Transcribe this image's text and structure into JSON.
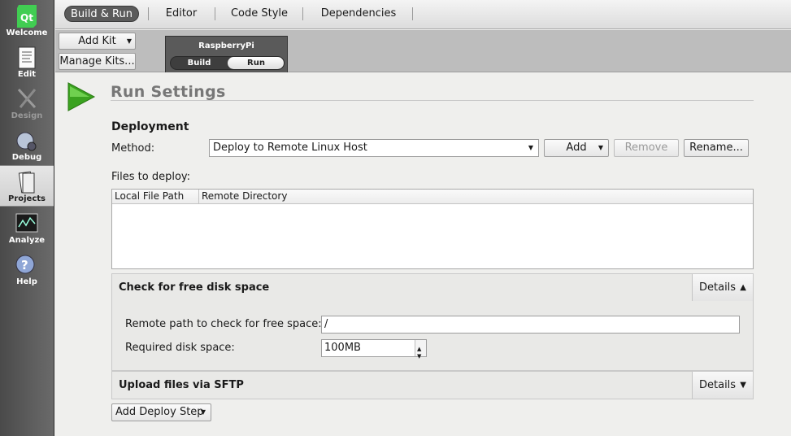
{
  "modebar": {
    "items": [
      {
        "label": "Welcome",
        "icon": "qt-logo-icon"
      },
      {
        "label": "Edit",
        "icon": "document-icon"
      },
      {
        "label": "Design",
        "icon": "design-tools-icon"
      },
      {
        "label": "Debug",
        "icon": "bug-icon"
      },
      {
        "label": "Projects",
        "icon": "projects-icon"
      },
      {
        "label": "Analyze",
        "icon": "analyze-icon"
      },
      {
        "label": "Help",
        "icon": "help-icon"
      }
    ],
    "active": "Projects",
    "disabled": "Design"
  },
  "topbar": {
    "tabs": [
      "Build & Run",
      "Editor",
      "Code Style",
      "Dependencies"
    ],
    "active": "Build & Run"
  },
  "kitbar": {
    "add_kit": "Add Kit",
    "manage_kits": "Manage Kits...",
    "kit_name": "RaspberryPi",
    "build": "Build",
    "run": "Run",
    "active": "Run"
  },
  "main": {
    "title": "Run Settings",
    "deployment": {
      "heading": "Deployment",
      "method_label": "Method:",
      "method_value": "Deploy to Remote Linux Host",
      "add": "Add",
      "remove": "Remove",
      "rename": "Rename...",
      "files_label": "Files to deploy:",
      "columns": [
        "Local File Path",
        "Remote Directory"
      ]
    },
    "steps": [
      {
        "title": "Check for free disk space",
        "details": "Details",
        "expanded": true,
        "remote_path_label": "Remote path to check for free space:",
        "remote_path_value": "/",
        "required_label": "Required disk space:",
        "required_value": "100MB"
      },
      {
        "title": "Upload files via SFTP",
        "details": "Details",
        "expanded": false
      }
    ],
    "add_deploy_step": "Add Deploy Step"
  },
  "colors": {
    "accent_green": "#3aa21f",
    "modebar_dark": "#4a4a4a"
  }
}
